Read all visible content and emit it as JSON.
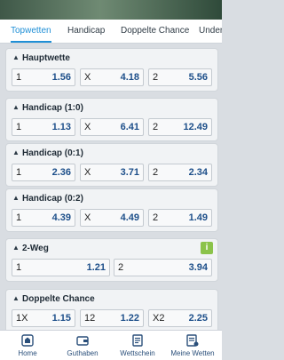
{
  "tabs": [
    "Topwetten",
    "Handicap",
    "Doppelte Chance",
    "Under/"
  ],
  "markets": [
    {
      "title": "Hauptwette",
      "odds": [
        {
          "label": "1",
          "value": "1.56"
        },
        {
          "label": "X",
          "value": "4.18"
        },
        {
          "label": "2",
          "value": "5.56"
        }
      ]
    },
    {
      "title": "Handicap (1:0)",
      "odds": [
        {
          "label": "1",
          "value": "1.13"
        },
        {
          "label": "X",
          "value": "6.41"
        },
        {
          "label": "2",
          "value": "12.49"
        }
      ]
    },
    {
      "title": "Handicap (0:1)",
      "odds": [
        {
          "label": "1",
          "value": "2.36"
        },
        {
          "label": "X",
          "value": "3.71"
        },
        {
          "label": "2",
          "value": "2.34"
        }
      ]
    },
    {
      "title": "Handicap (0:2)",
      "odds": [
        {
          "label": "1",
          "value": "4.39"
        },
        {
          "label": "X",
          "value": "4.49"
        },
        {
          "label": "2",
          "value": "1.49"
        }
      ]
    },
    {
      "title": "2-Weg",
      "info": "i",
      "odds": [
        {
          "label": "1",
          "value": "1.21"
        },
        {
          "label": "2",
          "value": "3.94"
        }
      ]
    },
    {
      "title": "Doppelte Chance",
      "odds": [
        {
          "label": "1X",
          "value": "1.15"
        },
        {
          "label": "12",
          "value": "1.22"
        },
        {
          "label": "X2",
          "value": "2.25"
        }
      ]
    }
  ],
  "nav": [
    "Home",
    "Guthaben",
    "Wettschein",
    "Meine Wetten"
  ],
  "colors": {
    "accent": "#1f8fd6",
    "odds_text": "#1d4f8a",
    "info_green": "#8bc34a"
  }
}
